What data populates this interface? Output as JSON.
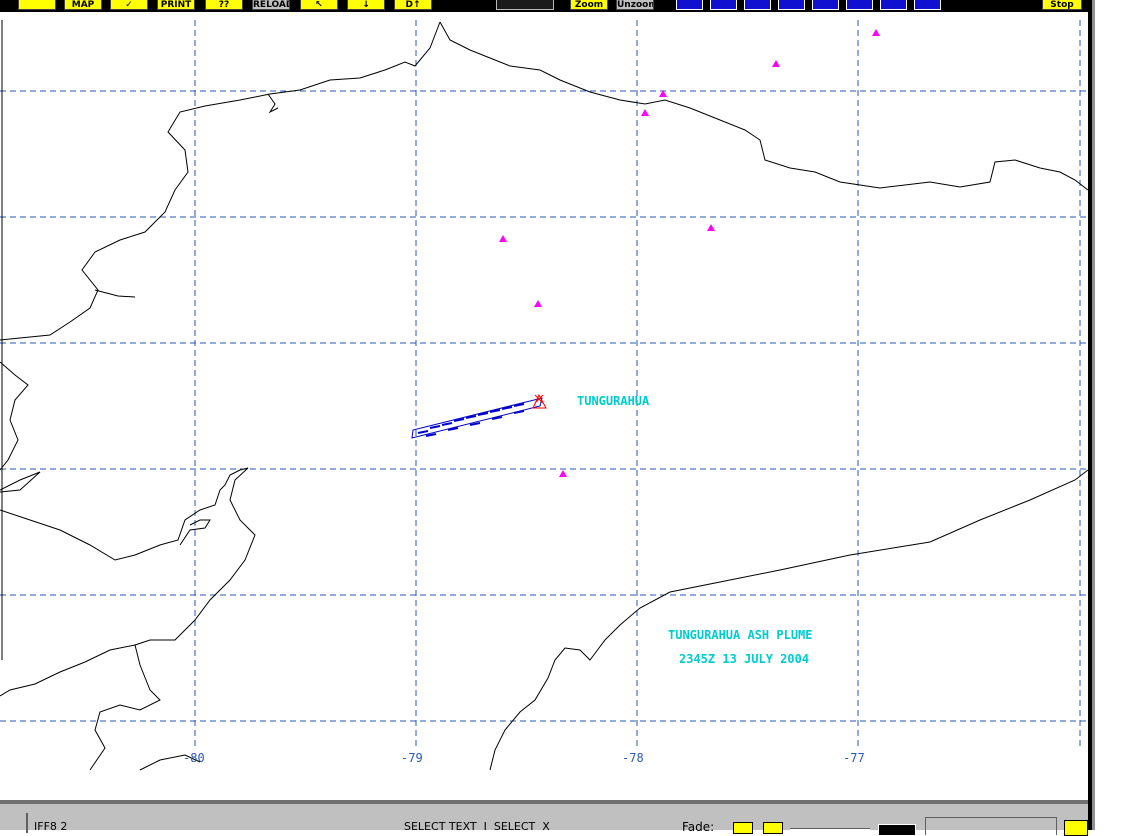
{
  "toolbar": {
    "buttons": [
      {
        "label": ""
      },
      {
        "label": "MAP"
      },
      {
        "label": "✓"
      },
      {
        "label": "PRINT"
      },
      {
        "label": "??"
      },
      {
        "label": "RELOAD"
      },
      {
        "label": "↖"
      },
      {
        "label": "↓"
      },
      {
        "label": "D↑"
      },
      {
        "label": ""
      },
      {
        "label": "Zoom"
      },
      {
        "label": "Unzoom"
      },
      {
        "label": "Stop"
      }
    ]
  },
  "map": {
    "lon_labels": [
      "-80",
      "-79",
      "-78",
      "-77"
    ],
    "volcano_label": "TUNGURAHUA",
    "annotation_line1": "TUNGURAHUA ASH PLUME",
    "annotation_line2": "2345Z 13 JULY 2004",
    "colors": {
      "grid": "#2a5ab8",
      "coast": "#000000",
      "volcano_marker": "#ff00ff",
      "label_text": "#00cccc",
      "plume": "#0000cc",
      "vent": "#ff0000"
    }
  },
  "bottombar": {
    "left_text": "IFF8 2",
    "center_text": "SELECT TEXT  I  SELECT  X",
    "fade_label": "Fade:"
  }
}
